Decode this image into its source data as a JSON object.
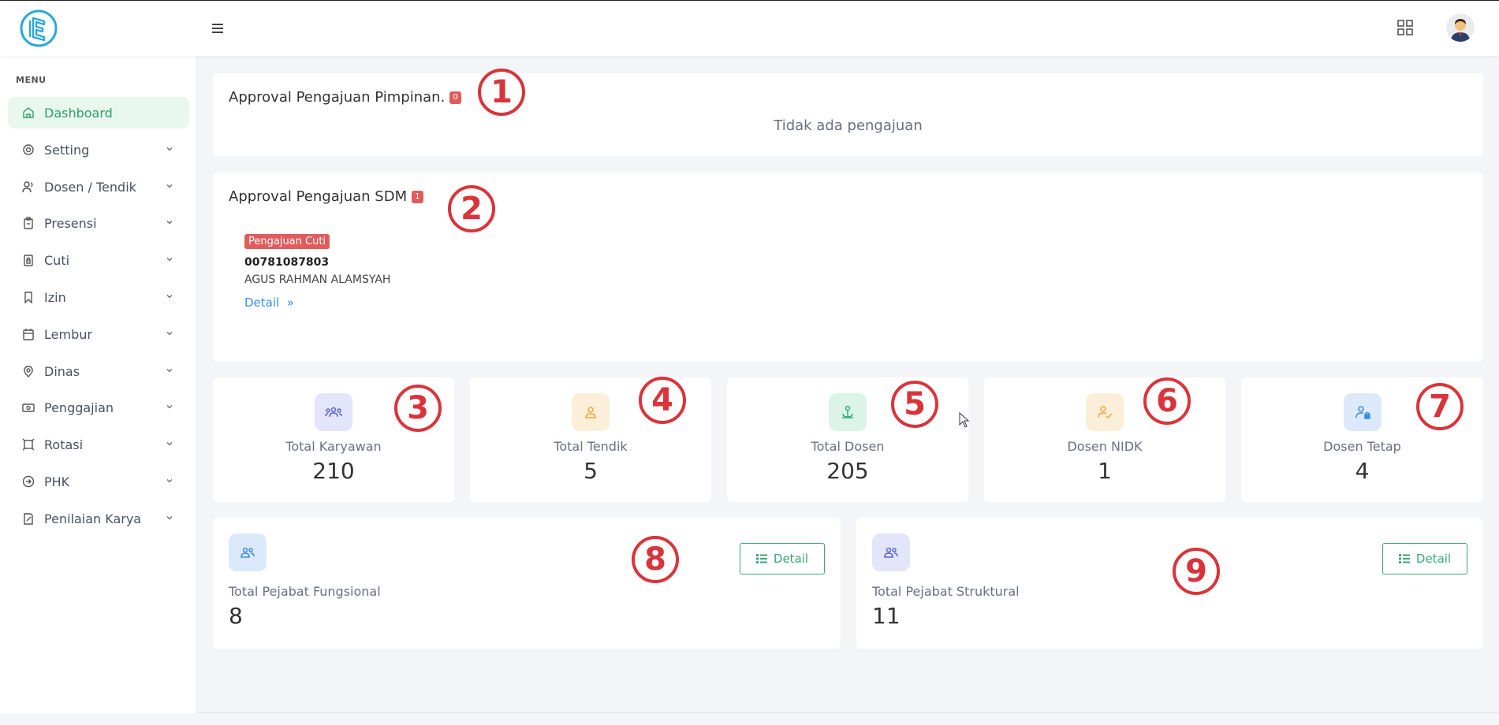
{
  "sidebar": {
    "menu_title": "MENU",
    "items": [
      {
        "label": "Dashboard",
        "icon": "home-icon"
      },
      {
        "label": "Setting",
        "icon": "gear-icon"
      },
      {
        "label": "Dosen / Tendik",
        "icon": "users-icon"
      },
      {
        "label": "Presensi",
        "icon": "clipboard-icon"
      },
      {
        "label": "Cuti",
        "icon": "file-lock-icon"
      },
      {
        "label": "Izin",
        "icon": "bookmark-icon"
      },
      {
        "label": "Lembur",
        "icon": "calendar-icon"
      },
      {
        "label": "Dinas",
        "icon": "map-pin-icon"
      },
      {
        "label": "Penggajian",
        "icon": "money-icon"
      },
      {
        "label": "Rotasi",
        "icon": "rotate-icon"
      },
      {
        "label": "PHK",
        "icon": "logout-icon"
      },
      {
        "label": "Penilaian Karya",
        "icon": "edit-doc-icon"
      }
    ]
  },
  "approval_pimpinan": {
    "title": "Approval Pengajuan Pimpinan.",
    "badge": "0",
    "empty_text": "Tidak ada pengajuan"
  },
  "approval_sdm": {
    "title": "Approval Pengajuan SDM",
    "badge": "1",
    "request": {
      "type": "Pengajuan Cuti",
      "nik": "00781087803",
      "name": "AGUS RAHMAN ALAMSYAH",
      "link": "Detail"
    }
  },
  "stats": [
    {
      "label": "Total Karyawan",
      "value": "210",
      "icon": "users-group-icon"
    },
    {
      "label": "Total Tendik",
      "value": "5",
      "icon": "user-icon"
    },
    {
      "label": "Total Dosen",
      "value": "205",
      "icon": "user-anchor-icon"
    },
    {
      "label": "Dosen NIDK",
      "value": "1",
      "icon": "user-check-icon"
    },
    {
      "label": "Dosen Tetap",
      "value": "4",
      "icon": "user-lock-icon"
    }
  ],
  "pejabat": [
    {
      "label": "Total Pejabat Fungsional",
      "value": "8",
      "button": "Detail"
    },
    {
      "label": "Total Pejabat Struktural",
      "value": "11",
      "button": "Detail"
    }
  ],
  "annotations": [
    "1",
    "2",
    "3",
    "4",
    "5",
    "6",
    "7",
    "8",
    "9"
  ],
  "colors": {
    "accent_green": "#3aa876",
    "badge_red": "#e05c5c",
    "annotation_red": "#d9343b",
    "link_blue": "#3a8ee6"
  }
}
